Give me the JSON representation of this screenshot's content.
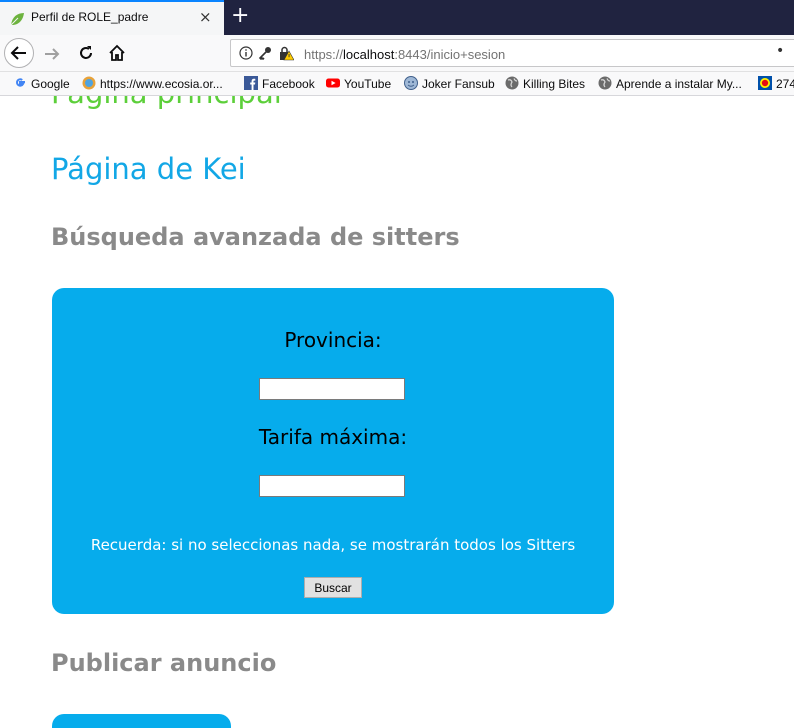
{
  "browser": {
    "tab_title": "Perfil de ROLE_padre",
    "new_tab_symbol": "+",
    "close_symbol": "×",
    "url_prefix": "https://",
    "url_host": "localhost",
    "url_rest": ":8443/inicio+sesion",
    "overflow_symbol": "•",
    "bookmarks": [
      {
        "label": "Google",
        "icon": "google-icon"
      },
      {
        "label": "https://www.ecosia.or...",
        "icon": "ecosia-icon"
      },
      {
        "label": "Facebook",
        "icon": "facebook-icon"
      },
      {
        "label": "YouTube",
        "icon": "youtube-icon"
      },
      {
        "label": "Joker Fansub",
        "icon": "joker-icon"
      },
      {
        "label": "Killing Bites",
        "icon": "globe-icon"
      },
      {
        "label": "Aprende a instalar My...",
        "icon": "globe-icon"
      },
      {
        "label": "274",
        "icon": "lidl-icon"
      }
    ]
  },
  "page": {
    "link_main": "Página principal",
    "link_kei": "Página de Kei",
    "search_heading": "Búsqueda avanzada de sitters",
    "search_form": {
      "provincia_label": "Provincia:",
      "provincia_value": "",
      "tarifa_label": "Tarifa máxima:",
      "tarifa_value": "",
      "hint": "Recuerda: si no seleccionas nada, se mostrarán todos los Sitters",
      "submit_label": "Buscar"
    },
    "publish_heading": "Publicar anuncio"
  },
  "colors": {
    "box_blue": "#06acec",
    "link_green": "#5ccf3a",
    "link_blue": "#12a7e6",
    "heading_gray": "#8a8a8a"
  }
}
